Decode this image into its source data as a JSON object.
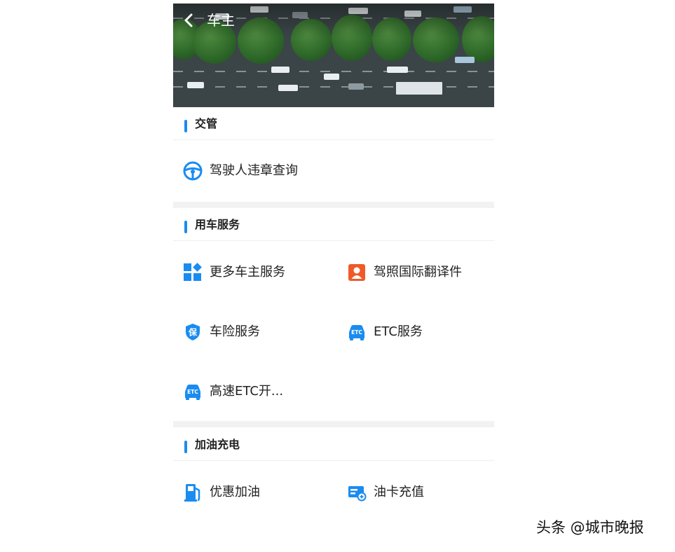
{
  "header": {
    "title": "车主",
    "back_icon": "chevron-left-icon"
  },
  "sections": [
    {
      "title": "交管",
      "items": [
        {
          "label": "驾驶人违章查询",
          "icon": "steering-wheel-icon",
          "color": "#1a8cf0"
        }
      ]
    },
    {
      "title": "用车服务",
      "items": [
        {
          "label": "更多车主服务",
          "icon": "grid-apps-icon",
          "color": "#1a8cf0"
        },
        {
          "label": "驾照国际翻译件",
          "icon": "license-person-icon",
          "color": "#f05a28"
        },
        {
          "label": "车险服务",
          "icon": "insurance-shield-icon",
          "color": "#1a8cf0"
        },
        {
          "label": "ETC服务",
          "icon": "etc-car-icon",
          "color": "#1a8cf0"
        },
        {
          "label": "高速ETC开...",
          "icon": "etc-car-icon",
          "color": "#1a8cf0"
        }
      ]
    },
    {
      "title": "加油充电",
      "items": [
        {
          "label": "优惠加油",
          "icon": "fuel-pump-icon",
          "color": "#1a8cf0"
        },
        {
          "label": "油卡充值",
          "icon": "fuel-card-icon",
          "color": "#1a8cf0"
        }
      ]
    }
  ],
  "icon_text": {
    "insurance": "保",
    "etc": "ETC"
  },
  "watermark": "头条 @城市晚报",
  "colors": {
    "accent": "#1a8cf0",
    "orange": "#f05a28",
    "divider": "#f2f2f2"
  }
}
